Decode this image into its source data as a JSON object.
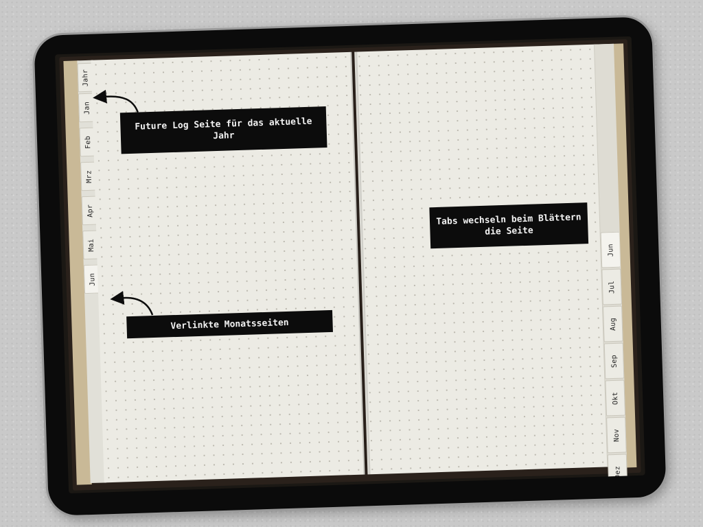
{
  "left_tabs": [
    {
      "label": "Jahr",
      "active": false
    },
    {
      "label": "Jan",
      "active": false
    },
    {
      "label": "Feb",
      "active": false
    },
    {
      "label": "Mrz",
      "active": false
    },
    {
      "label": "Apr",
      "active": false
    },
    {
      "label": "Mai",
      "active": false
    },
    {
      "label": "Jun",
      "active": true
    }
  ],
  "right_tabs": [
    {
      "label": "Jun",
      "active": true
    },
    {
      "label": "Jul",
      "active": false
    },
    {
      "label": "Aug",
      "active": false
    },
    {
      "label": "Sep",
      "active": false
    },
    {
      "label": "Okt",
      "active": false
    },
    {
      "label": "Nov",
      "active": false
    },
    {
      "label": "Dez",
      "active": false
    }
  ],
  "callouts": {
    "future_log": "Future Log Seite für das aktuelle Jahr",
    "monthly_pages": "Verlinkte Monatsseiten",
    "tabs_switch": "Tabs wechseln beim Blättern die Seite"
  },
  "colors": {
    "tablet_bezel": "#0b0b0b",
    "paper": "#ecebe4",
    "callout_bg": "#0c0c0c",
    "callout_text": "#f2f2f2",
    "page_edge": "#c9b997"
  }
}
